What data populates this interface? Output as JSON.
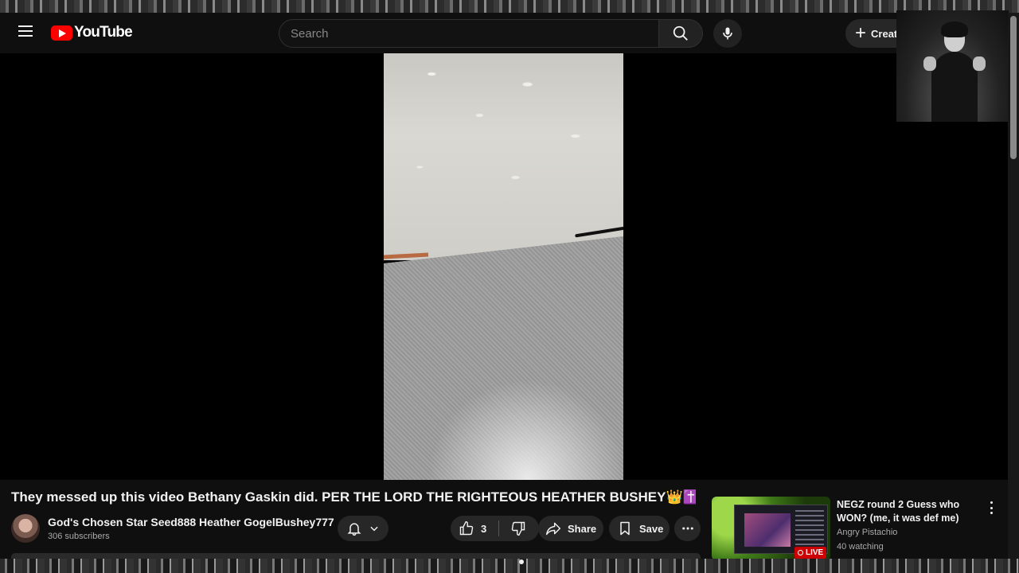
{
  "masthead": {
    "logo_text": "YouTube",
    "search_placeholder": "Search",
    "create_label": "Create"
  },
  "video": {
    "title": "They messed up this video Bethany Gaskin did. PER THE LORD THE RIGHTEOUS HEATHER BUSHEY",
    "title_emoji": "👑✝️🎺",
    "channel_name": "God's Chosen Star Seed888 Heather GogelBushey777",
    "subscribers": "306 subscribers",
    "like_count": "3",
    "share_label": "Share",
    "save_label": "Save"
  },
  "recommended": {
    "title": "NEGZ round 2 Guess who WON? (me, it was def me)",
    "channel": "Angry Pistachio",
    "viewers": "40 watching",
    "badge": "LIVE"
  },
  "colors": {
    "brand_red": "#ff0000",
    "live_red": "#cc0000",
    "background": "#0f0f0f"
  }
}
